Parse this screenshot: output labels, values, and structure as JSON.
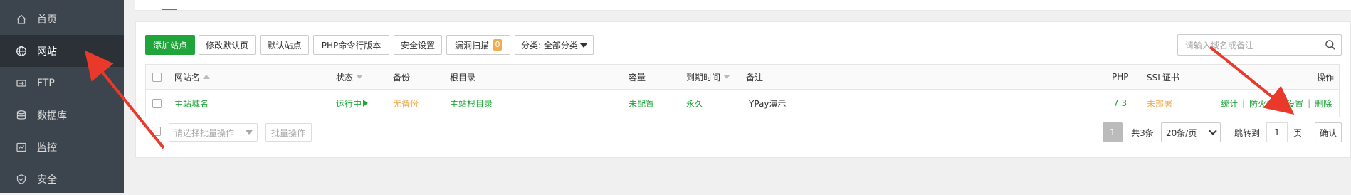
{
  "sidebar": {
    "items": [
      {
        "label": "首页",
        "icon": "home-icon"
      },
      {
        "label": "网站",
        "icon": "globe-icon"
      },
      {
        "label": "FTP",
        "icon": "ftp-icon"
      },
      {
        "label": "数据库",
        "icon": "database-icon"
      },
      {
        "label": "监控",
        "icon": "monitor-icon"
      },
      {
        "label": "安全",
        "icon": "shield-icon"
      }
    ],
    "active_index": 1,
    "bg_color": "#3c444d",
    "active_color": "#2c3138"
  },
  "toolbar": {
    "add_site": "添加站点",
    "modify_default_page": "修改默认页",
    "default_site": "默认站点",
    "php_cli_version": "PHP命令行版本",
    "security_settings": "安全设置",
    "vuln_scan": "漏洞扫描",
    "vuln_count": "0",
    "category": "分类: 全部分类"
  },
  "search": {
    "placeholder": "请输入域名或备注"
  },
  "table": {
    "headers": {
      "site_name": "网站名",
      "status": "状态",
      "backup": "备份",
      "root_dir": "根目录",
      "capacity": "容量",
      "expiry": "到期时间",
      "remark": "备注",
      "php": "PHP",
      "ssl": "SSL证书",
      "actions": "操作"
    },
    "rows": [
      {
        "site_name": "主站域名",
        "status": "运行中",
        "backup": "无备份",
        "root_dir": "主站根目录",
        "capacity": "未配置",
        "expiry": "永久",
        "remark": "YPay演示",
        "php": "7.3",
        "ssl": "未部署",
        "actions": [
          "统计",
          "防火墙",
          "设置",
          "删除"
        ]
      }
    ]
  },
  "footer": {
    "batch_placeholder": "请选择批量操作",
    "batch_button": "批量操作",
    "current_page": "1",
    "total": "共3条",
    "page_size": "20条/页",
    "jump_label": "跳转到",
    "jump_value": "1",
    "page_unit": "页",
    "confirm": "确认"
  },
  "colors": {
    "accent": "#20a53a",
    "warning": "#f0ad4e",
    "annotation_arrow": "#e8392b"
  }
}
